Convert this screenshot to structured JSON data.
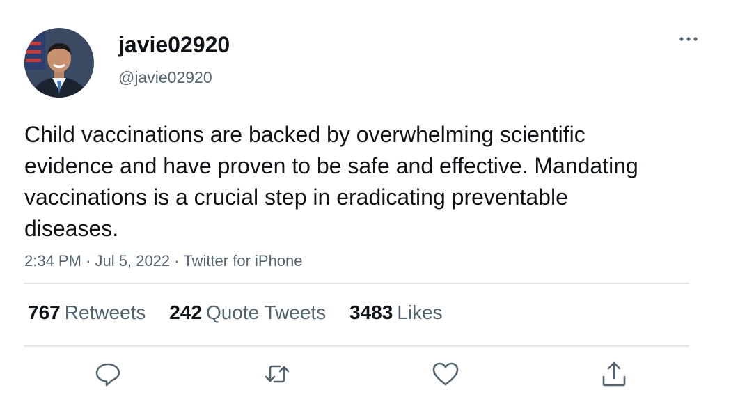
{
  "author": {
    "display_name": "javie02920",
    "handle": "@javie02920",
    "avatar_icon": "profile-photo"
  },
  "tweet": {
    "text": "Child vaccinations are backed by overwhelming scientific evidence and have proven to be safe and effective. Mandating vaccinations is a crucial step in eradicating preventable diseases.",
    "time": "2:34 PM",
    "date": "Jul 5, 2022",
    "source": "Twitter for iPhone",
    "separator": "·"
  },
  "stats": {
    "retweets": {
      "count": "767",
      "label": "Retweets"
    },
    "quotes": {
      "count": "242",
      "label": "Quote Tweets"
    },
    "likes": {
      "count": "3483",
      "label": "Likes"
    }
  },
  "actions": [
    {
      "icon": "reply-icon"
    },
    {
      "icon": "retweet-icon"
    },
    {
      "icon": "like-icon"
    },
    {
      "icon": "share-icon"
    }
  ],
  "colors": {
    "text_primary": "#0f1419",
    "text_secondary": "#536471",
    "divider": "#e1e6ea",
    "icon": "#536471"
  }
}
